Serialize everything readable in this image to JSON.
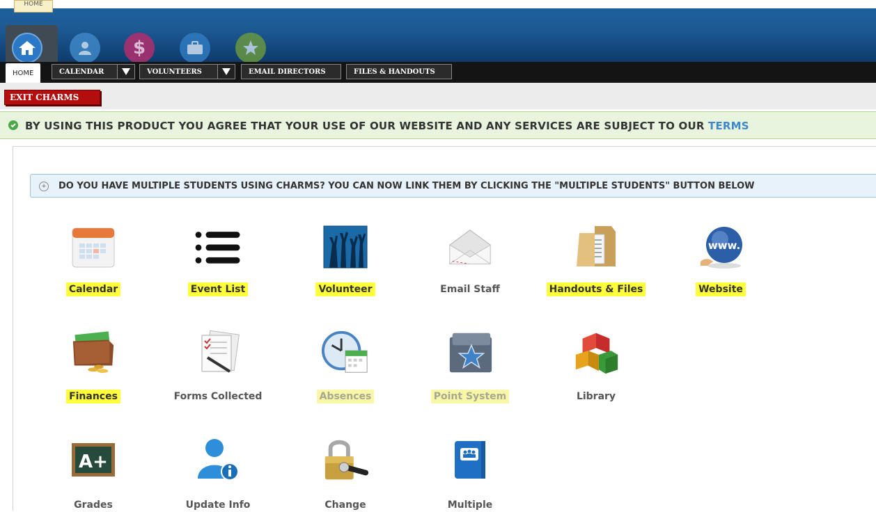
{
  "top_bar": {
    "home_tooltip": "HOME",
    "icons": [
      {
        "name": "home-icon",
        "color": "#2a78c6"
      },
      {
        "name": "person-icon",
        "color": "#3d87c7"
      },
      {
        "name": "dollar-icon",
        "color": "#b2357e"
      },
      {
        "name": "briefcase-icon",
        "color": "#2f7ac0"
      },
      {
        "name": "star-icon",
        "color": "#6d9b3e"
      }
    ]
  },
  "tabs": [
    {
      "label": "HOME"
    },
    {
      "label": "CALENDAR",
      "dropdown": true
    },
    {
      "label": "VOLUNTEERS",
      "dropdown": true
    },
    {
      "label": "EMAIL DIRECTORS"
    },
    {
      "label": "FILES & HANDOUTS"
    }
  ],
  "exit_label": "EXIT CHARMS",
  "agreement": {
    "text": "BY USING THIS PRODUCT YOU AGREE THAT YOUR USE OF OUR WEBSITE AND ANY SERVICES ARE SUBJECT TO OUR",
    "link": "TERMS"
  },
  "info_banner": "DO YOU HAVE MULTIPLE STUDENTS USING CHARMS? YOU CAN NOW LINK THEM BY CLICKING THE \"MULTIPLE STUDENTS\" BUTTON BELOW",
  "tiles": [
    {
      "label": "Calendar",
      "icon": "calendar-icon",
      "highlight": "yes"
    },
    {
      "label": "Event List",
      "icon": "list-icon",
      "highlight": "yes"
    },
    {
      "label": "Volunteer",
      "icon": "raised-hands-icon",
      "highlight": "yes"
    },
    {
      "label": "Email Staff",
      "icon": "envelope-icon",
      "highlight": "no"
    },
    {
      "label": "Handouts & Files",
      "icon": "folder-icon",
      "highlight": "yes"
    },
    {
      "label": "Website",
      "icon": "globe-icon",
      "highlight": "yes"
    },
    {
      "label": "Finances",
      "icon": "wallet-icon",
      "highlight": "yes"
    },
    {
      "label": "Forms Collected",
      "icon": "forms-icon",
      "highlight": "no"
    },
    {
      "label": "Absences",
      "icon": "clock-calendar-icon",
      "highlight": "soft"
    },
    {
      "label": "Point System",
      "icon": "star-box-icon",
      "highlight": "soft"
    },
    {
      "label": "Library",
      "icon": "blocks-icon",
      "highlight": "no"
    },
    {
      "label": "Grades",
      "icon": "chalkboard-icon",
      "highlight": "no"
    },
    {
      "label": "Update Info",
      "icon": "user-info-icon",
      "highlight": "no"
    },
    {
      "label": "Change",
      "icon": "padlock-key-icon",
      "highlight": "no"
    },
    {
      "label": "Multiple",
      "icon": "group-book-icon",
      "highlight": "no"
    }
  ]
}
